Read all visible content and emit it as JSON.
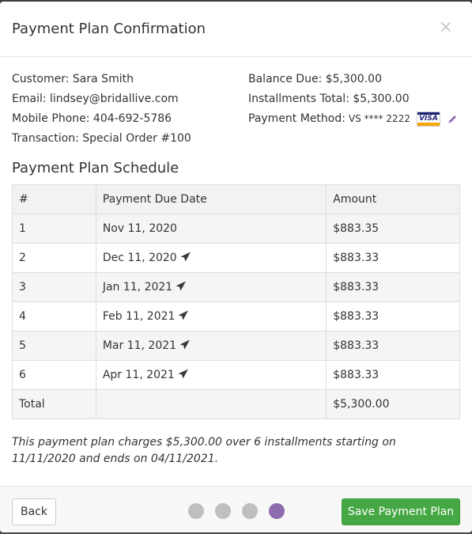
{
  "modal": {
    "title": "Payment Plan Confirmation",
    "close_glyph": "×"
  },
  "customer": {
    "customer": "Customer: Sara Smith",
    "email": "Email: lindsey@bridallive.com",
    "phone": "Mobile Phone: 404-692-5786",
    "transaction": "Transaction: Special Order #100"
  },
  "balance": {
    "balance_due": "Balance Due: $5,300.00",
    "installments_total": "Installments Total: $5,300.00",
    "payment_method_label": "Payment Method:",
    "payment_method_value": "VS **** 2222",
    "card_brand": "VISA"
  },
  "schedule": {
    "title": "Payment Plan Schedule",
    "headers": [
      "#",
      "Payment Due Date",
      "Amount"
    ],
    "rows": [
      {
        "num": "1",
        "date": "Nov 11, 2020",
        "amount": "$883.35",
        "send_icon": false
      },
      {
        "num": "2",
        "date": "Dec 11, 2020",
        "amount": "$883.33",
        "send_icon": true
      },
      {
        "num": "3",
        "date": "Jan 11, 2021",
        "amount": "$883.33",
        "send_icon": true
      },
      {
        "num": "4",
        "date": "Feb 11, 2021",
        "amount": "$883.33",
        "send_icon": true
      },
      {
        "num": "5",
        "date": "Mar 11, 2021",
        "amount": "$883.33",
        "send_icon": true
      },
      {
        "num": "6",
        "date": "Apr 11, 2021",
        "amount": "$883.33",
        "send_icon": true
      }
    ],
    "total_label": "Total",
    "total_amount": "$5,300.00"
  },
  "summary": "This payment plan charges $5,300.00 over 6 installments starting on 11/11/2020 and ends on 04/11/2021.",
  "footer": {
    "back_label": "Back",
    "save_label": "Save Payment Plan",
    "steps_total": 4,
    "active_step": 4
  },
  "colors": {
    "save_button": "#46a845",
    "active_dot": "#8f6bb0",
    "inactive_dot": "#bfbfbf",
    "pencil": "#8f6bb0"
  },
  "icons": {
    "close": "close-icon",
    "card": "visa-card-icon",
    "edit": "pencil-icon",
    "send": "paper-plane-icon"
  }
}
